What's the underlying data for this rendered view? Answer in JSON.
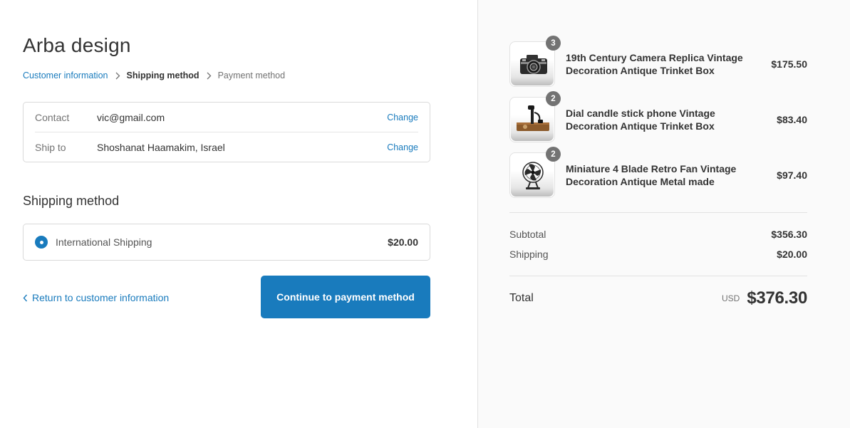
{
  "store": {
    "title": "Arba design"
  },
  "breadcrumb": {
    "items": [
      {
        "label": "Customer information"
      },
      {
        "label": "Shipping method"
      },
      {
        "label": "Payment method"
      }
    ]
  },
  "review": {
    "contact_label": "Contact",
    "contact_value": "vic@gmail.com",
    "ship_to_label": "Ship to",
    "ship_to_value": "Shoshanat Haamakim, Israel",
    "change_label": "Change"
  },
  "shipping": {
    "section_title": "Shipping method",
    "option_name": "International Shipping",
    "option_price": "$20.00",
    "selected": true
  },
  "actions": {
    "return_label": "Return to customer information",
    "continue_label": "Continue to payment method"
  },
  "order": {
    "items": [
      {
        "quantity": "3",
        "name": "19th Century Camera Replica Vintage Decoration Antique Trinket Box",
        "price": "$175.50",
        "thumb_icon": "camera-icon"
      },
      {
        "quantity": "2",
        "name": "Dial candle stick phone Vintage Decoration Antique Trinket Box",
        "price": "$83.40",
        "thumb_icon": "phone-icon"
      },
      {
        "quantity": "2",
        "name": "Miniature 4 Blade Retro Fan Vintage Decoration Antique Metal made",
        "price": "$97.40",
        "thumb_icon": "fan-icon"
      }
    ],
    "subtotal_label": "Subtotal",
    "subtotal_value": "$356.30",
    "shipping_label": "Shipping",
    "shipping_value": "$20.00",
    "total_label": "Total",
    "currency": "USD",
    "total_value": "$376.30"
  },
  "colors": {
    "accent": "#197bbd",
    "sidebar_bg": "#fafafa",
    "badge": "#737373"
  }
}
